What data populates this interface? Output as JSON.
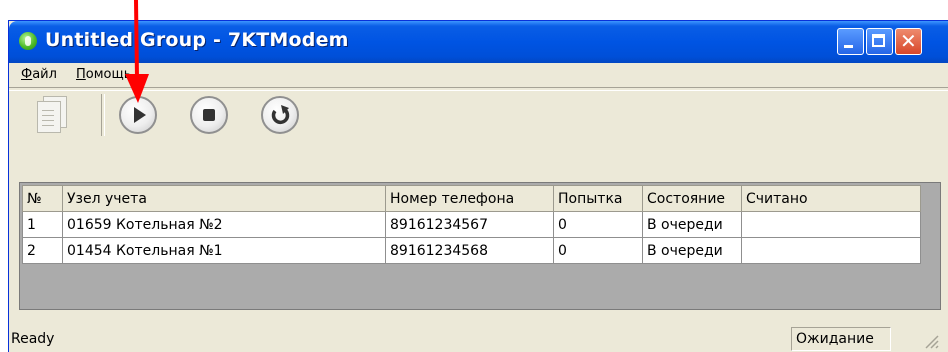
{
  "window": {
    "title": "Untitled Group - 7KTModem",
    "app_icon": "app-globe-icon",
    "controls": [
      "minimize-icon",
      "maximize-icon",
      "close-icon"
    ]
  },
  "menu": {
    "file": {
      "accel": "Ф",
      "rest": "айл"
    },
    "help": {
      "accel": "П",
      "rest": "омощь"
    }
  },
  "toolbar": {
    "buttons": [
      "document-icon",
      "play-icon",
      "stop-icon",
      "refresh-icon"
    ]
  },
  "table": {
    "headers": [
      "№",
      "Узел учета",
      "Номер телефона",
      "Попытка",
      "Состояние",
      "Считано"
    ],
    "rows": [
      [
        "1",
        "01659 Котельная №2",
        "89161234567",
        "0",
        "В очереди",
        ""
      ],
      [
        "2",
        "01454 Котельная №1",
        "89161234568",
        "0",
        "В очереди",
        ""
      ]
    ]
  },
  "status": {
    "text": "Ready",
    "pane": "Ожидание"
  },
  "annotation": {
    "arrow_color": "#ff0000",
    "points_to": "play-button"
  },
  "colors": {
    "title_bar": "#0054e3",
    "window_face": "#ece9d8",
    "close_button": "#d8472a"
  }
}
